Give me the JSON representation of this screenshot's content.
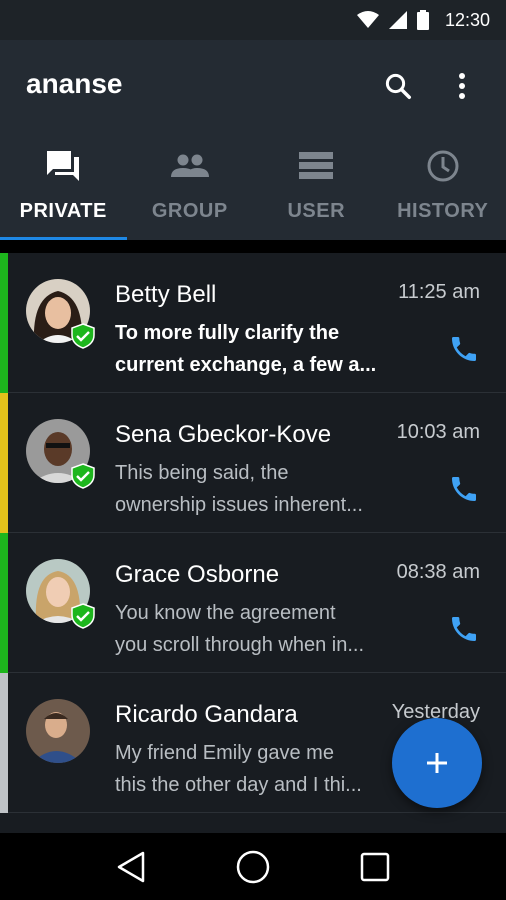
{
  "status_bar": {
    "time": "12:30"
  },
  "app_bar": {
    "title": "ananse"
  },
  "tabs": [
    {
      "label": "PRIVATE",
      "icon": "chat-icon",
      "active": true
    },
    {
      "label": "GROUP",
      "icon": "group-icon",
      "active": false
    },
    {
      "label": "USER",
      "icon": "list-icon",
      "active": false
    },
    {
      "label": "HISTORY",
      "icon": "clock-icon",
      "active": false
    }
  ],
  "conversations": [
    {
      "name": "Betty Bell",
      "time": "11:25 am",
      "preview_line1": "To more fully clarify the",
      "preview_line2": "current exchange, a few a...",
      "unread": true,
      "strip_color": "#1db61d",
      "verified": true
    },
    {
      "name": "Sena Gbeckor-Kove",
      "time": "10:03 am",
      "preview_line1": "This being said, the",
      "preview_line2": "ownership issues inherent...",
      "unread": false,
      "strip_color": "#e3c21b",
      "verified": true
    },
    {
      "name": "Grace Osborne",
      "time": "08:38 am",
      "preview_line1": "You know the agreement",
      "preview_line2": "you scroll through when in...",
      "unread": false,
      "strip_color": "#1db61d",
      "verified": true
    },
    {
      "name": "Ricardo Gandara",
      "time": "Yesterday",
      "preview_line1": "My friend Emily gave me",
      "preview_line2": "this the other day and I thi...",
      "unread": false,
      "strip_color": "#bfc3c7",
      "verified": false
    }
  ],
  "colors": {
    "accent": "#1e88e5",
    "fab": "#1e6fd0",
    "verified": "#1db61d"
  }
}
